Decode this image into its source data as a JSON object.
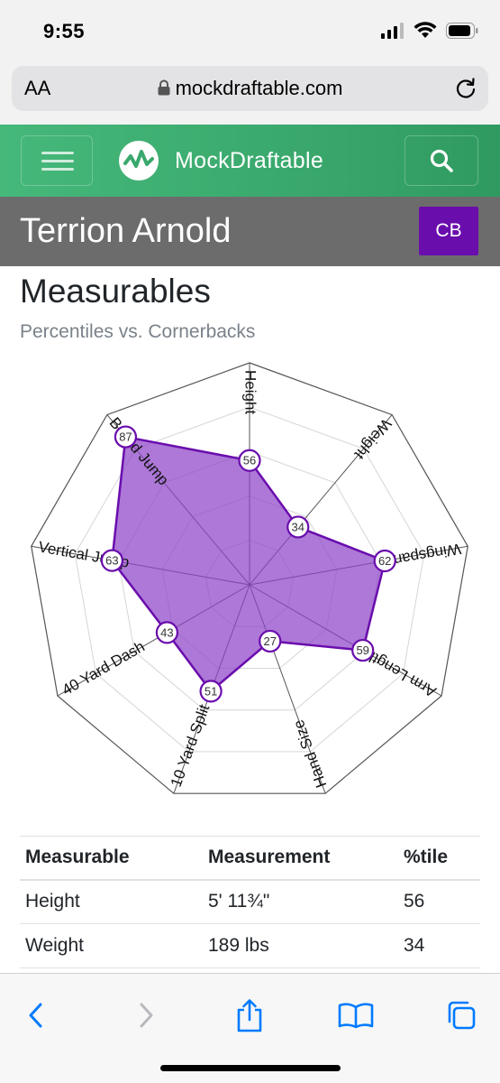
{
  "status_bar": {
    "time": "9:55"
  },
  "browser": {
    "text_size_label": "AA",
    "url": "mockdraftable.com"
  },
  "site": {
    "brand": "MockDraftable"
  },
  "player": {
    "name": "Terrion Arnold",
    "position": "CB"
  },
  "section": {
    "title": "Measurables",
    "subtitle": "Percentiles vs. Cornerbacks"
  },
  "chart_data": {
    "type": "radar",
    "title": "",
    "range": [
      0,
      100
    ],
    "grid": true,
    "axes": [
      "Height",
      "Weight",
      "Wingspan",
      "Arm Length",
      "Hand Size",
      "10 Yard Split",
      "40 Yard Dash",
      "Vertical Jump",
      "Broad Jump"
    ],
    "values": [
      56,
      34,
      62,
      59,
      27,
      51,
      43,
      63,
      87
    ],
    "fill_color": "#8e44c8",
    "stroke_color": "#6a0dad"
  },
  "table": {
    "headers": [
      "Measurable",
      "Measurement",
      "%tile"
    ],
    "rows": [
      [
        "Height",
        "5' 11¾\"",
        "56"
      ],
      [
        "Weight",
        "189 lbs",
        "34"
      ]
    ]
  },
  "colors": {
    "accent": "#6a0dad",
    "navbar": "#3fae72",
    "header_bg": "#6c6c6c",
    "ios_blue": "#007aff"
  }
}
